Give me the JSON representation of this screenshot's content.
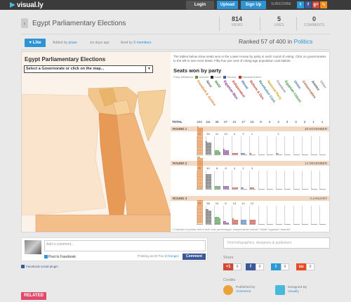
{
  "header": {
    "logo": "visual.ly",
    "login": "Login",
    "upload": "Upload",
    "signup": "Sign Up",
    "subscribe": "SUBSCRIBE",
    "social": [
      "t",
      "f",
      "g+",
      "rss"
    ]
  },
  "title": {
    "text": "Egypt Parliamentary Elections",
    "views_num": "814",
    "views_lbl": "VIEWS",
    "likes_num": "5",
    "likes_lbl": "LIKES",
    "comments_num": "0",
    "comments_lbl": "COMMENTS"
  },
  "meta": {
    "like": "Like",
    "added_by": "Added by",
    "author": "ptsan",
    "when": "six days ago",
    "liked_by": "liked by",
    "members": "5 members",
    "ranked": "Ranked 57 of 400 in",
    "category": "Politics"
  },
  "map": {
    "title": "Egypt Parliamentary Elections",
    "select": "Select a Governorate or click on the map..."
  },
  "panel": {
    "intro": "The tables below show seats won in the Lower House by party in each round of voting. Click on governorates to the left to see more detail. Fifty-four per cent of voting-age population cast ballots.",
    "title": "Seats won by party",
    "legend_lbl": "Party Affiliations",
    "legend_items": [
      {
        "name": "Islamist",
        "color": "#6b8f3c"
      },
      {
        "name": "Salafi",
        "color": "#2b2b2b"
      },
      {
        "name": "Secular",
        "color": "#3f5ea8"
      },
      {
        "name": "Mubarak-linked",
        "color": "#c0392b"
      }
    ],
    "total_label": "TOTAL",
    "parties": [
      {
        "name": "Freedom & Justice",
        "color": "#e07a28"
      },
      {
        "name": "Nour",
        "color": "#555555"
      },
      {
        "name": "Wafd",
        "color": "#3a8a3a"
      },
      {
        "name": "Egyptian Bloc",
        "color": "#7b2f8e"
      },
      {
        "name": "Independent",
        "color": "#c0392b"
      },
      {
        "name": "Wasat",
        "color": "#3a6fb0"
      },
      {
        "name": "Reform & Dev.",
        "color": "#c0392b"
      },
      {
        "name": "Revolution Cont.",
        "color": "#2f7f8e"
      },
      {
        "name": "National Party",
        "color": "#c8a020"
      },
      {
        "name": "Freedom",
        "color": "#888888"
      },
      {
        "name": "Egyptian Citizen",
        "color": "#3a8a3a"
      },
      {
        "name": "Union",
        "color": "#3a6fb0"
      },
      {
        "name": "Conservative",
        "color": "#a0522d"
      },
      {
        "name": "Justice",
        "color": "#444444"
      },
      {
        "name": "Other",
        "color": "#999999"
      }
    ],
    "totals": [
      "223",
      "111",
      "38",
      "27",
      "21",
      "17",
      "16",
      "8",
      "4",
      "3",
      "3",
      "3",
      "2",
      "1",
      "1"
    ],
    "rounds": [
      {
        "label": "ROUND 1",
        "date": "28 NOVEMBER",
        "counts": [
          "73",
          "33",
          "11",
          "13",
          "4",
          "3",
          "1",
          "",
          "",
          "2",
          "",
          "",
          "",
          "",
          ""
        ]
      },
      {
        "label": "ROUND 2",
        "date": "14 DECEMBER",
        "counts": [
          "86",
          "40",
          "8",
          "8",
          "4",
          "2",
          "3",
          "",
          "",
          "",
          "",
          "",
          "",
          "",
          ""
        ]
      },
      {
        "label": "ROUND 3",
        "date": "3 JANUARY",
        "counts": [
          "64",
          "38",
          "19",
          "6",
          "13",
          "12",
          "12",
          "",
          "",
          "",
          "",
          "",
          "",
          "",
          ""
        ]
      }
    ],
    "footnote": "* A handful of parties tied in their vote percentages. Independents include \"Salafi\" regarded \"Islamist\""
  },
  "comment": {
    "placeholder": "Add a comment...",
    "post_fb": "Post to Facebook",
    "posting_as": "Posting as",
    "posting_name": "El Fox",
    "change": "(Change)",
    "button": "Comment",
    "fb_plugin": "Facebook social plugin"
  },
  "sidebar": {
    "search_placeholder": "Find infographics, designers & publishers",
    "share_lbl": "Share",
    "shares": [
      {
        "icon": "+1",
        "count": "0",
        "color": "#d14836"
      },
      {
        "icon": "f",
        "count": "0",
        "color": "#3b5998"
      },
      {
        "icon": "t",
        "count": "0",
        "color": "#2c9ad6"
      },
      {
        "icon": "su",
        "count": "0",
        "color": "#eb4924"
      }
    ],
    "credits_lbl": "Credits",
    "published_by": "Published by",
    "publisher": "AlJazeera",
    "designed_by": "Designed By",
    "designer": "visually"
  },
  "related": "RELATED"
}
